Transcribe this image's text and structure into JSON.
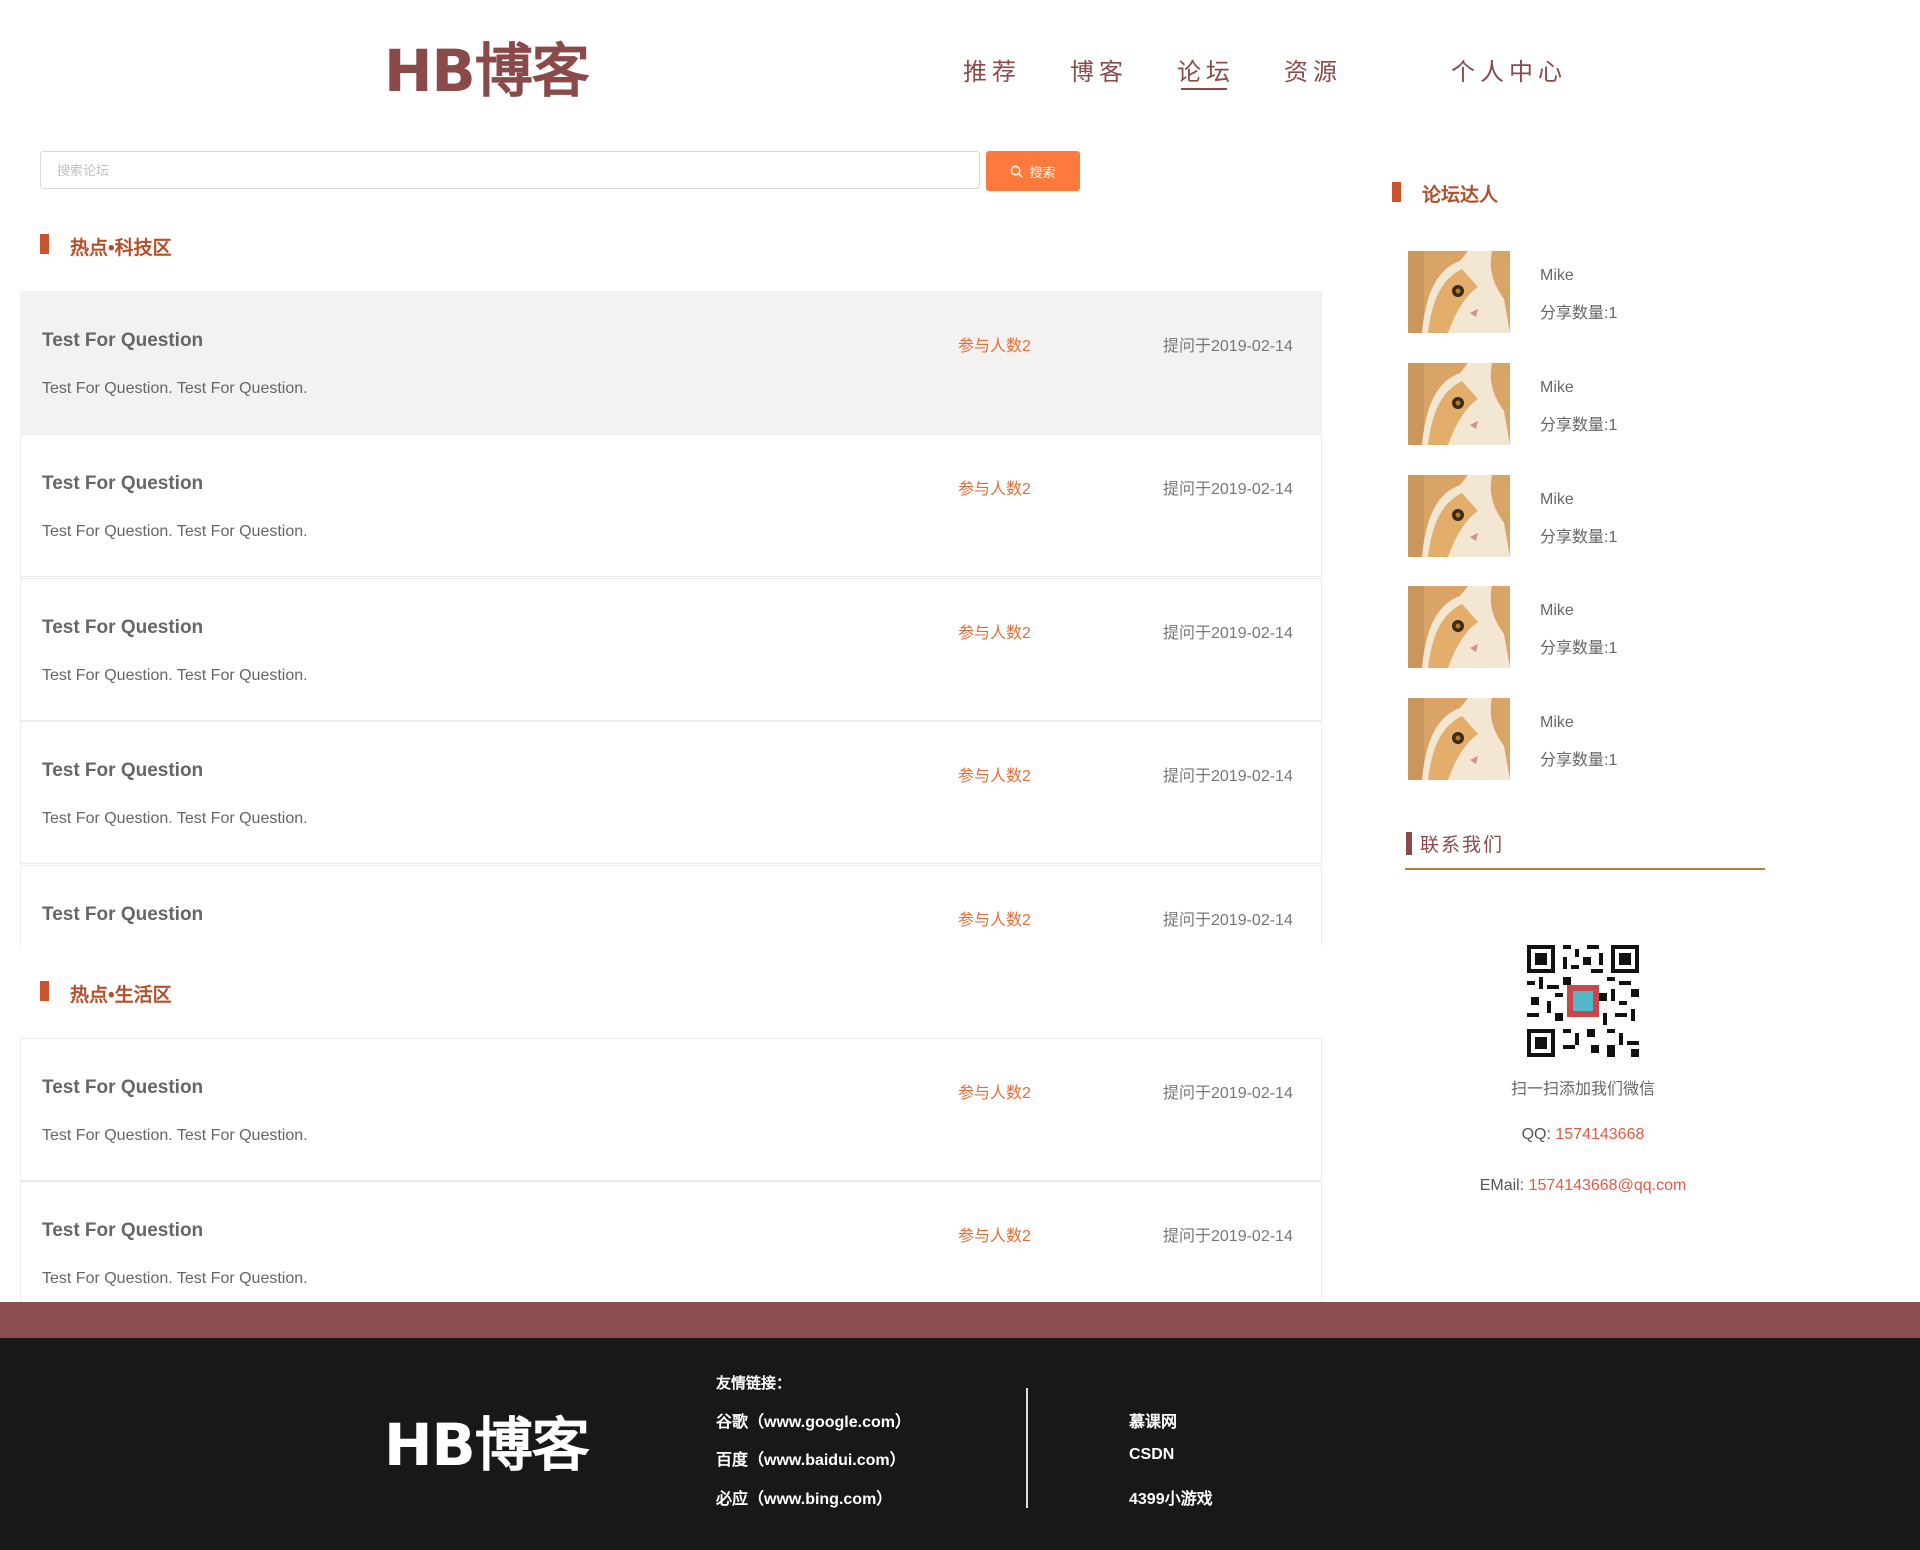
{
  "brand": {
    "logo_text": "HB博客"
  },
  "nav": {
    "items": [
      {
        "label": "推荐"
      },
      {
        "label": "博客"
      },
      {
        "label": "论坛"
      },
      {
        "label": "资源"
      },
      {
        "label": "个人中心"
      }
    ],
    "active": "论坛"
  },
  "search": {
    "placeholder": "搜索论坛",
    "button_label": "搜索"
  },
  "sections": [
    {
      "title": "热点•科技区",
      "questions": [
        {
          "title": "Test For Question",
          "participants": "参与人数2",
          "date": "提问于2019-02-14",
          "desc": "Test For Question. Test For Question."
        },
        {
          "title": "Test For Question",
          "participants": "参与人数2",
          "date": "提问于2019-02-14",
          "desc": "Test For Question. Test For Question."
        },
        {
          "title": "Test For Question",
          "participants": "参与人数2",
          "date": "提问于2019-02-14",
          "desc": "Test For Question. Test For Question."
        },
        {
          "title": "Test For Question",
          "participants": "参与人数2",
          "date": "提问于2019-02-14",
          "desc": "Test For Question. Test For Question."
        },
        {
          "title": "Test For Question",
          "participants": "参与人数2",
          "date": "提问于2019-02-14",
          "desc": ""
        }
      ]
    },
    {
      "title": "热点•生活区",
      "questions": [
        {
          "title": "Test For Question",
          "participants": "参与人数2",
          "date": "提问于2019-02-14",
          "desc": "Test For Question. Test For Question."
        },
        {
          "title": "Test For Question",
          "participants": "参与人数2",
          "date": "提问于2019-02-14",
          "desc": "Test For Question. Test For Question."
        }
      ]
    }
  ],
  "sidebar": {
    "experts_title": "论坛达人",
    "experts": [
      {
        "name": "Mike",
        "count": "分享数量:1"
      },
      {
        "name": "Mike",
        "count": "分享数量:1"
      },
      {
        "name": "Mike",
        "count": "分享数量:1"
      },
      {
        "name": "Mike",
        "count": "分享数量:1"
      },
      {
        "name": "Mike",
        "count": "分享数量:1"
      }
    ],
    "contact_title": "联系我们",
    "qr_caption": "扫一扫添加我们微信",
    "qq_label": "QQ: ",
    "qq": "1574143668",
    "email_label": "EMail: ",
    "email": "1574143668@qq.com"
  },
  "footer": {
    "logo_text": "HB博客",
    "links_title": "友情链接：",
    "links": [
      "谷歌（www.google.com）",
      "百度（www.baidui.com）",
      "必应（www.bing.com）"
    ],
    "links2": [
      "慕课网",
      "CSDN",
      "4399小游戏"
    ]
  },
  "colors": {
    "brand": "#8b4a4a",
    "accent": "#fd7a3c",
    "section": "#c8532c",
    "link": "#e05a45"
  }
}
